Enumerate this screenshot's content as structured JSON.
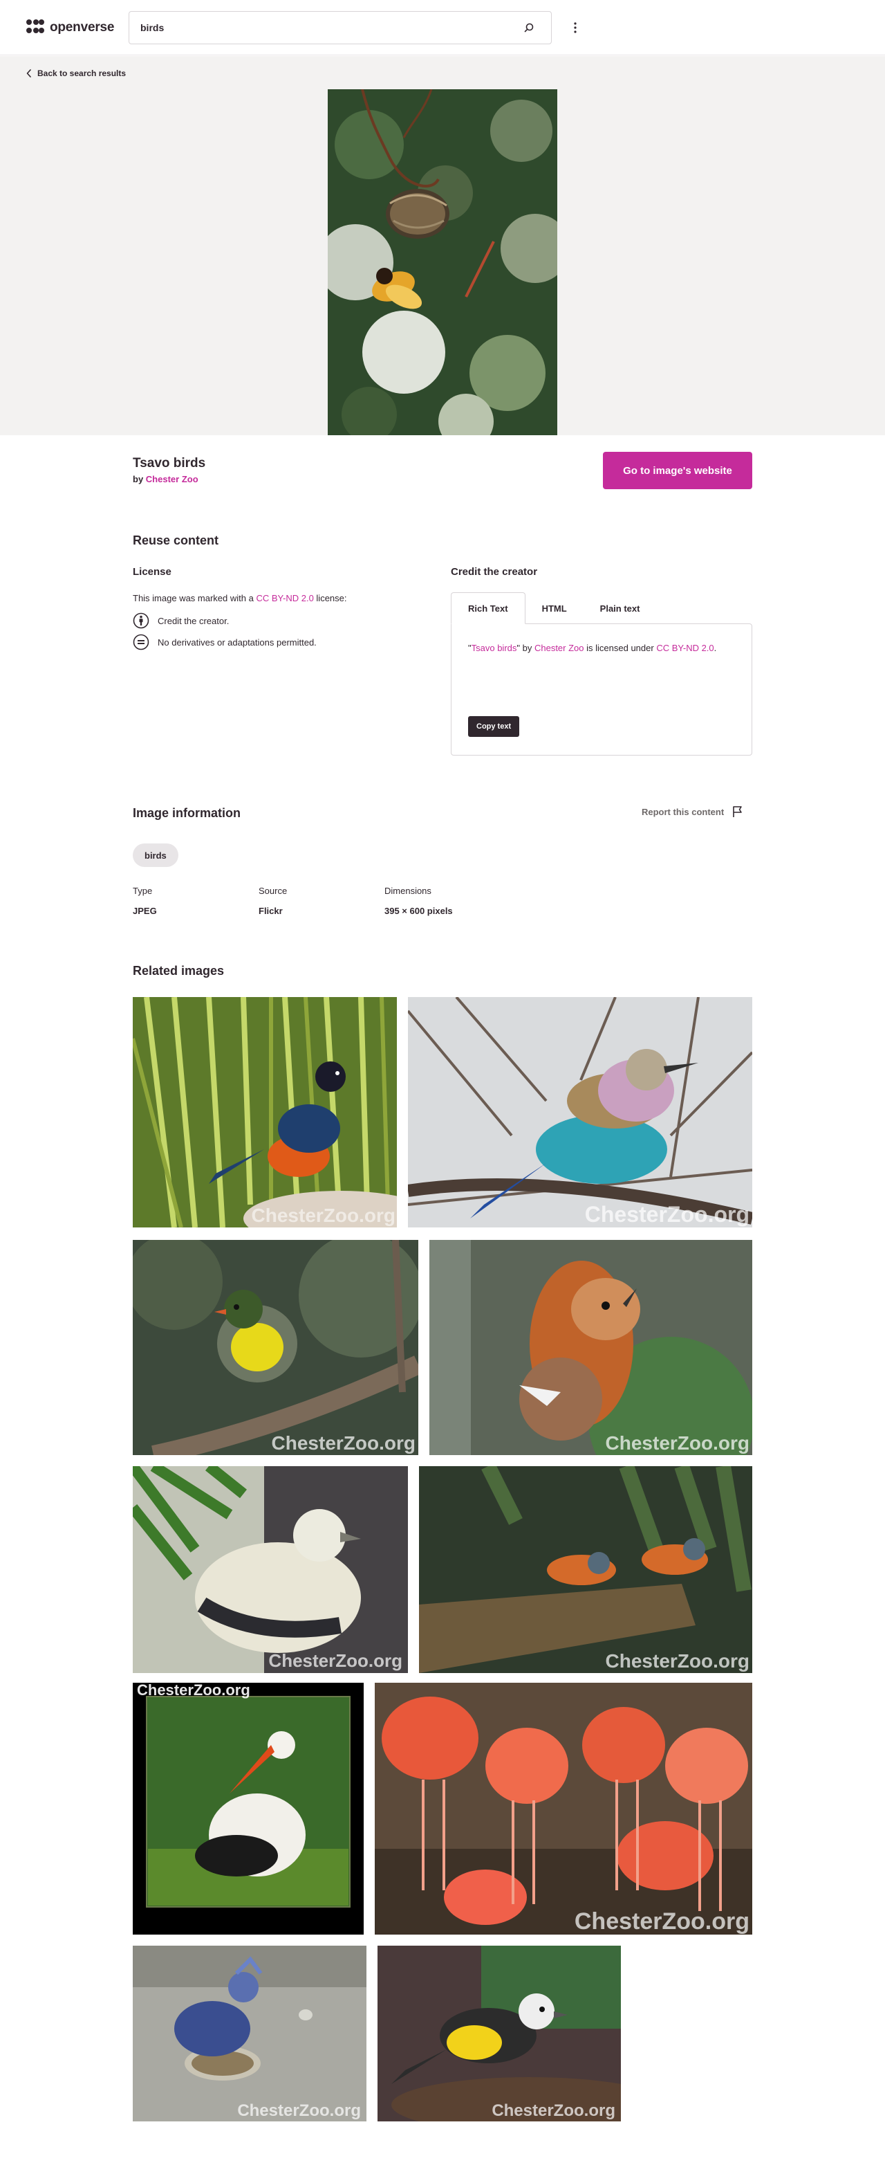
{
  "header": {
    "logo_text": "openverse",
    "search": {
      "value": "birds"
    }
  },
  "hero": {
    "back_label": "Back to search results"
  },
  "image": {
    "title": "Tsavo birds",
    "by_prefix": "by",
    "creator": "Chester Zoo",
    "go_button": "Go to image's website"
  },
  "reuse": {
    "heading": "Reuse content",
    "license_heading": "License",
    "license_intro": "This image was marked with a",
    "license_name": "CC BY-ND 2.0",
    "license_suffix": "license:",
    "conditions": [
      {
        "icon": "by-icon",
        "text": "Credit the creator."
      },
      {
        "icon": "nd-icon",
        "text": "No derivatives or adaptations permitted."
      }
    ],
    "credit_heading": "Credit the creator",
    "tabs": [
      "Rich Text",
      "HTML",
      "Plain text"
    ],
    "active_tab": "Rich Text",
    "attribution": {
      "q_open": "\"",
      "title": "Tsavo birds",
      "q_close": "\" by",
      "creator": "Chester Zoo",
      "middle": "is licensed under",
      "license": "CC BY-ND 2.0",
      "end": "."
    },
    "copy_button": "Copy text"
  },
  "info": {
    "heading": "Image information",
    "report": "Report this content",
    "tag": "birds",
    "type_label": "Type",
    "type_value": "JPEG",
    "source_label": "Source",
    "source_value": "Flickr",
    "dimensions_label": "Dimensions",
    "dimensions_value": "395 × 600 pixels"
  },
  "related": {
    "heading": "Related images",
    "watermark": "ChesterZoo.org"
  },
  "colors": {
    "accent": "#c52b9b",
    "text": "#30272e",
    "hero_bg": "#f3f2f1"
  }
}
